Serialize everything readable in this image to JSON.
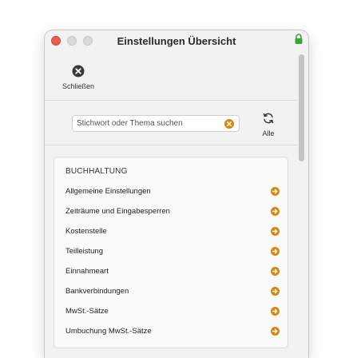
{
  "window": {
    "title": "Einstellungen Übersicht",
    "accent": "#d9860b",
    "lock_color": "#3aa63a"
  },
  "toolbar": {
    "close_label": "Schließen",
    "close_icon": "x-circle-icon"
  },
  "search": {
    "placeholder": "Stichwort oder Thema suchen",
    "value": "",
    "clear_icon": "clear-icon"
  },
  "alle": {
    "label": "Alle",
    "icon": "refresh-icon"
  },
  "section": {
    "title": "BUCHHALTUNG",
    "items": [
      {
        "label": "Allgemeine Einstellungen"
      },
      {
        "label": "Zeiträume und Eingabesperren"
      },
      {
        "label": "Kostenstelle"
      },
      {
        "label": "Teilleistung"
      },
      {
        "label": "Einnahmeart"
      },
      {
        "label": "Bankverbindungen"
      },
      {
        "label": "MwSt.-Sätze"
      },
      {
        "label": "Umbuchung MwSt.-Sätze"
      }
    ]
  }
}
